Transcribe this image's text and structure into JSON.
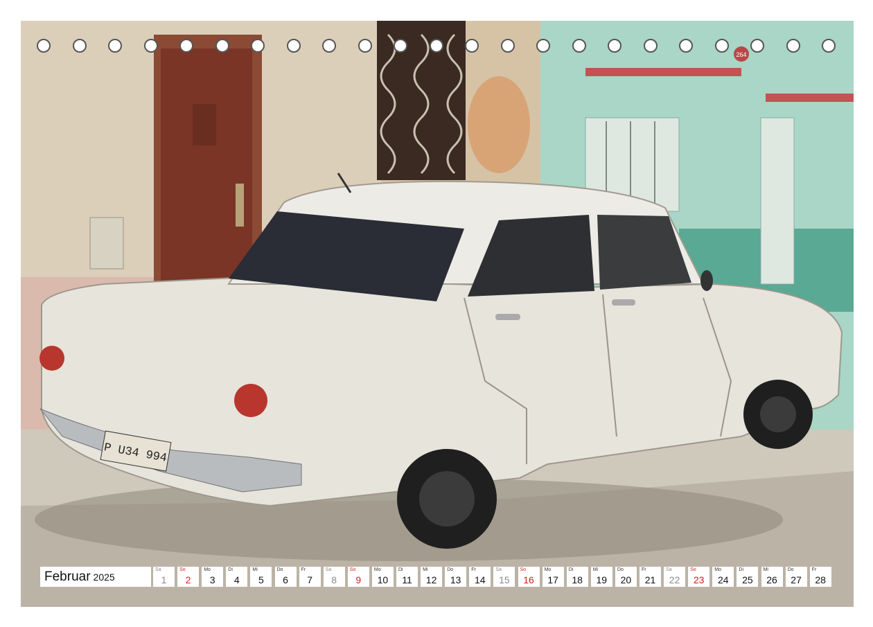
{
  "calendar": {
    "month": "Februar",
    "year": "2025",
    "days": [
      {
        "wd": "Sa",
        "d": "1",
        "type": "sat"
      },
      {
        "wd": "So",
        "d": "2",
        "type": "sun"
      },
      {
        "wd": "Mo",
        "d": "3",
        "type": "wk"
      },
      {
        "wd": "Di",
        "d": "4",
        "type": "wk"
      },
      {
        "wd": "Mi",
        "d": "5",
        "type": "wk"
      },
      {
        "wd": "Do",
        "d": "6",
        "type": "wk"
      },
      {
        "wd": "Fr",
        "d": "7",
        "type": "wk"
      },
      {
        "wd": "Sa",
        "d": "8",
        "type": "sat"
      },
      {
        "wd": "So",
        "d": "9",
        "type": "sun"
      },
      {
        "wd": "Mo",
        "d": "10",
        "type": "wk"
      },
      {
        "wd": "Di",
        "d": "11",
        "type": "wk"
      },
      {
        "wd": "Mi",
        "d": "12",
        "type": "wk"
      },
      {
        "wd": "Do",
        "d": "13",
        "type": "wk"
      },
      {
        "wd": "Fr",
        "d": "14",
        "type": "wk"
      },
      {
        "wd": "Sa",
        "d": "15",
        "type": "sat"
      },
      {
        "wd": "So",
        "d": "16",
        "type": "sun"
      },
      {
        "wd": "Mo",
        "d": "17",
        "type": "wk"
      },
      {
        "wd": "Di",
        "d": "18",
        "type": "wk"
      },
      {
        "wd": "Mi",
        "d": "19",
        "type": "wk"
      },
      {
        "wd": "Do",
        "d": "20",
        "type": "wk"
      },
      {
        "wd": "Fr",
        "d": "21",
        "type": "wk"
      },
      {
        "wd": "Sa",
        "d": "22",
        "type": "sat"
      },
      {
        "wd": "So",
        "d": "23",
        "type": "sun"
      },
      {
        "wd": "Mo",
        "d": "24",
        "type": "wk"
      },
      {
        "wd": "Di",
        "d": "25",
        "type": "wk"
      },
      {
        "wd": "Mi",
        "d": "26",
        "type": "wk"
      },
      {
        "wd": "Do",
        "d": "27",
        "type": "wk"
      },
      {
        "wd": "Fr",
        "d": "28",
        "type": "wk"
      }
    ]
  },
  "photo": {
    "plate_text": "P U34 994",
    "house_number": "264",
    "car_color": "#e9e6de",
    "wall_left_color": "#d9cdb8",
    "wall_right_color": "#a9d3c4"
  }
}
